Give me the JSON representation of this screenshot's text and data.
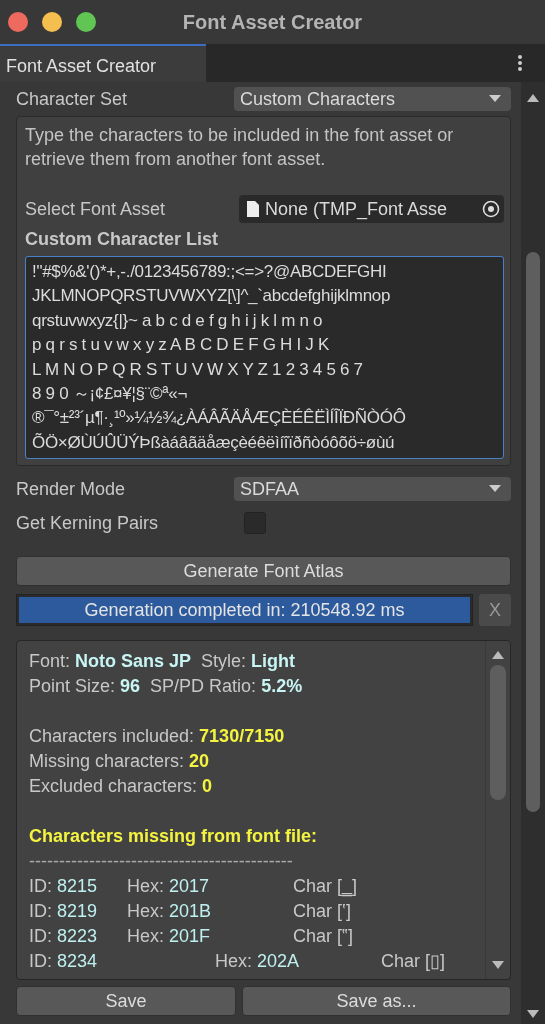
{
  "window": {
    "title": "Font Asset Creator"
  },
  "tabs": [
    {
      "label": "Font Asset Creator",
      "selected": true
    }
  ],
  "character_set": {
    "label": "Character Set",
    "value": "Custom Characters"
  },
  "help": {
    "text": "Type the characters to be included in the font asset or retrieve them from another font asset.",
    "select_font_asset": {
      "label": "Select Font Asset",
      "value": "None (TMP_Font Asse"
    },
    "list_label": "Custom Character List",
    "lines": [
      "!\"#$%&'()*+,-./0123456789:;<=>?@ABCDEFGHI",
      "JKLMNOPQRSTUVWXYZ[\\]^_`abcdefghijklmnop",
      "qrstuvwxyz{|}~ a b c d e f g h i j k l m n o",
      "p q r s t u v w x y z A B C D E F G H I J K",
      "L M N O P Q R S T U V W X Y Z 1 2 3 4 5 6 7",
      "8 9 0 ～¡¢£¤¥¦§¨©ª«¬",
      "®¯°±²³´µ¶·¸¹º»¼½¾¿ÀÁÂÃÄÅÆÇÈÉÊËÌÍÎÏÐÑÒÓÔ",
      "ÕÖ×ØÙÚÛÜÝÞßàáâãäåæçèéêëìíîïðñòóôõö÷øùú"
    ]
  },
  "render_mode": {
    "label": "Render Mode",
    "value": "SDFAA"
  },
  "kerning": {
    "label": "Get Kerning Pairs",
    "checked": false
  },
  "generate_button": "Generate Font Atlas",
  "progress": {
    "text": "Generation completed in: 210548.92 ms",
    "level": 1,
    "close": "X"
  },
  "report": {
    "info": [
      [
        {
          "label": "Font:",
          "value": "Noto Sans JP"
        },
        {
          "label": "Style:",
          "value": "Light"
        }
      ],
      [
        {
          "label": "Point Size:",
          "value": "96"
        },
        {
          "label": "SP/PD Ratio:",
          "value": "5.2%"
        }
      ]
    ],
    "counts": [
      {
        "label": "Characters included:",
        "value": "7130/7150"
      },
      {
        "label": "Missing characters:",
        "value": "20"
      },
      {
        "label": "Excluded characters:",
        "value": "0"
      }
    ],
    "missing_heading": "Characters missing from font file:",
    "divider": "--------------------------------------------",
    "missing": [
      {
        "kind": "plain",
        "id_label": "ID:",
        "id": "8215",
        "hex_label": "Hex:",
        "hex": "2017",
        "char": "Char [‗]"
      },
      {
        "kind": "plain",
        "id_label": "ID:",
        "id": "8219",
        "hex_label": "Hex:",
        "hex": "201B",
        "char": "Char [‛]"
      },
      {
        "kind": "plain",
        "id_label": "ID:",
        "id": "8223",
        "hex_label": "Hex:",
        "hex": "201F",
        "char": "Char [‟]"
      },
      {
        "kind": "wide",
        "id_label": "ID:",
        "id": "8234",
        "hex_label": "Hex:",
        "hex": "202A",
        "char": "Char [▯]"
      }
    ]
  },
  "buttons": [
    "Save",
    "Save as..."
  ]
}
